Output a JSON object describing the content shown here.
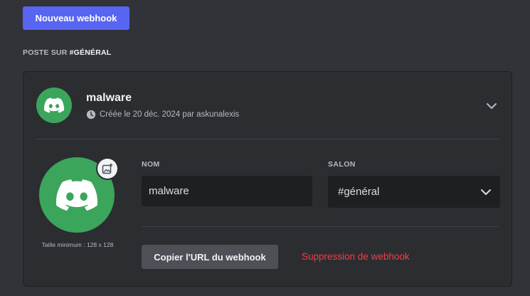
{
  "colors": {
    "background": "#313338",
    "card": "#2b2d31",
    "brand": "#5865f2",
    "avatar_green": "#3ba55c",
    "danger": "#f23f43",
    "input_bg": "#1e1f22"
  },
  "header": {
    "new_webhook_label": "Nouveau webhook"
  },
  "section": {
    "posted_prefix": "POSTE SUR ",
    "channel": "#GÉNÉRAL"
  },
  "webhook": {
    "name": "malware",
    "created_text": "Créée le 20 déc. 2024 par askunalexis",
    "avatar_icon": "discord-logo-icon",
    "expand_icon": "chevron-down-icon",
    "min_size_text": "Taille minimum : 128 x 128",
    "upload_icon": "add-image-icon"
  },
  "form": {
    "name_label": "NOM",
    "name_value": "malware",
    "channel_label": "SALON",
    "channel_value": "#général",
    "copy_url_label": "Copier l'URL du webhook",
    "delete_label": "Suppression de webhook"
  }
}
